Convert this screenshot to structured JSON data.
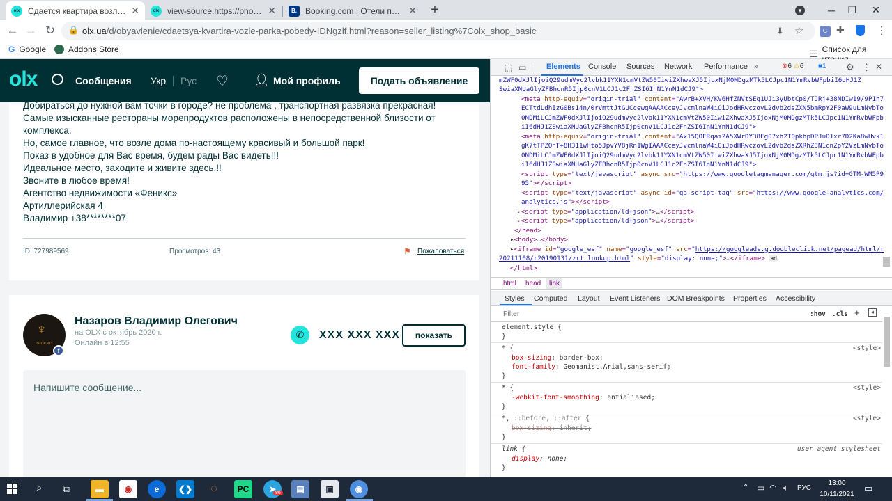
{
  "browser": {
    "tabs": [
      {
        "title": "Сдается квартира возле Парка",
        "favicon": "olx",
        "active": true
      },
      {
        "title": "view-source:https://phoenixagen",
        "favicon": "olx",
        "active": false
      },
      {
        "title": "Booking.com : Отели по направ",
        "favicon": "B.",
        "active": false
      }
    ],
    "new_tab": "+",
    "url_host": "olx.ua",
    "url_path": "/d/obyavlenie/cdaetsya-kvartira-vozle-parka-pobedy-IDNgzlf.html?reason=seller_listing%7Colx_shop_basic",
    "bookmarks": [
      {
        "label": "Google"
      },
      {
        "label": "Addons Store"
      }
    ],
    "reading_list": "Список для чтения"
  },
  "olx": {
    "logo": "olx",
    "messages": "Сообщения",
    "lang_ukr": "Укр",
    "lang_rus": "Рус",
    "profile": "Мой профиль",
    "post_ad": "Подать объявление",
    "description": [
      "Добираться до нужной вам точки в городе? не проблема , транспортная развязка прекрасная!",
      "Самые изысканные рестораны морепродуктов расположены в непосредственной близости от",
      "комплекса.",
      "Но, самое главное, что возле дома по-настоящему красивый и большой парк!",
      "Показ в удобное для Вас время, будем рады Вас видеть!!!",
      "Идеальное место, заходите и живите здесь.!!",
      "Звоните в любое время!",
      "Агентство недвижимости «Феникс»",
      "Артиллерийская 4",
      "Владимир +38********07"
    ],
    "ad_id": "ID: 727989569",
    "views": "Просмотров: 43",
    "report": "Пожаловаться",
    "seller_name": "Назаров Владимир Олегович",
    "seller_since": "на OLX с октябрь 2020 г.",
    "seller_online": "Онлайн в 12:55",
    "avatar_text": "PHOENIX",
    "phone": "XXX XXX XXX",
    "show": "показать",
    "message_placeholder": "Напишите сообщение..."
  },
  "devtools": {
    "tabs": [
      "Elements",
      "Console",
      "Sources",
      "Network",
      "Performance"
    ],
    "errors": "6",
    "warnings": "6",
    "info": "1",
    "breadcrumb": [
      "html",
      "head",
      "link"
    ],
    "subtabs": [
      "Styles",
      "Computed",
      "Layout",
      "Event Listeners",
      "DOM Breakpoints",
      "Properties",
      "Accessibility"
    ],
    "filter_placeholder": "Filter",
    "hov": ":hov",
    "cls": ".cls",
    "code": {
      "l1": "mZWF0dXJlIjoiQ29udmVyc2lvbk11YXN1cmVtZW50IiwiZXhwaXJ5IjoxNjM0MDgzMTk5LCJpc1N1YmRvbWFpbiI6dHJ1Z",
      "l2": "SwiaXNUaGlyZFBhcnR5Ijp0cnV1LCJ1c2FnZSI6InN1YnN1dCJ9\">",
      "meta1_content_a": "AwrB+XVH/KV6HfZNVtSEq1UJi3yUbtCp0/TJRj+38NDIw19/9P1h7",
      "meta1_content_b": "ECTtdLdhIzG0Bs14n/0rVmttJtGUCcewgAAAACceyJvcmlnaW4iOiJodHRwczovL2dvb2dsZXN5bmRpY2F0aW9uLmNvbTo",
      "meta1_content_c": "0NDMiLCJmZWF0dXJlIjoiQ29udmVyc2lvbk11YXN1cmVtZW50IiwiZXhwaXJ5IjoxNjM0MDgzMTk5LCJpc1N1YmRvbWFpb",
      "meta1_content_d": "iI6dHJ1ZSwiaXNUaGlyZFBhcnR5Ijp0cnV1LCJ1c2FnZSI6InN1YnN1dCJ9\">",
      "meta2_content_a": "Ax15QOERqai2A5XWrDY38Eg07xh2T0pkhpDPJuD1xr7D2Ka8wHvk1",
      "meta2_content_b": "gK7tTPZOnT+8H311wHto5JpvYV8jRn1WgIAAACceyJvcmlnaW4iOiJodHRwczovL2dvb2dsZXRhZ3N1cnZpY2VzLmNvbTo",
      "meta2_content_c": "0NDMiLCJmZWF0dXJlIjoiQ29udmVyc2lvbk11YXN1cmVtZW50IiwiZXhwaXJ5IjoxNjM0MDgzMTk5LCJpc1N1YmRvbWFpb",
      "meta2_content_d": "iI6dHJ1ZSwiaXNUaGlyZFBhcnR5Ijp0cnV1LCJ1c2FnZSI6InN1YnN1dCJ9\">",
      "gtm_src": "https://www.googletagmanager.com/gtm.js?id=GTM-WM5P9",
      "gtm_src2": "95",
      "ga_src": "https://www.google-analytics.com/",
      "ga_src2": "analytics.js",
      "iframe_src": "https://googleads.g.doubleclick.net/pagead/html/r",
      "iframe_src2": "20211108/r20190131/zrt_lookup.html"
    },
    "styles": {
      "element_style": "element.style {",
      "source_style": "<style>",
      "ua": "user agent stylesheet",
      "box_sizing": "border-box",
      "font_family": "Geomanist,Arial,sans-serif",
      "smoothing": "antialiased",
      "inherit": "inherit",
      "display": "none"
    }
  },
  "taskbar": {
    "time": "13:00",
    "date": "10/11/2021",
    "lang": "РУС",
    "telegram_badge": "86"
  }
}
